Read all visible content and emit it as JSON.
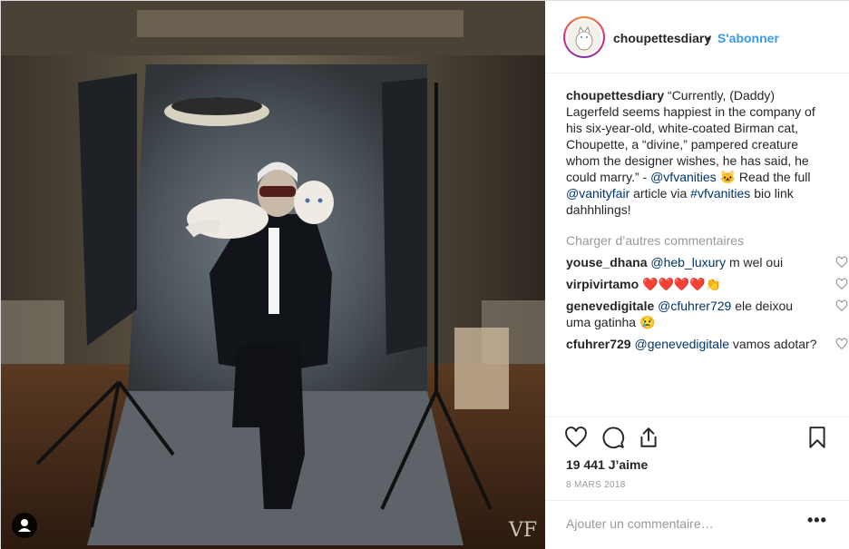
{
  "colors": {
    "accent": "#3897f0",
    "link": "#003569",
    "muted": "#999999",
    "heart_red": "#ed4956"
  },
  "photo": {
    "watermark": "VF",
    "user_tag_icon": "user-icon"
  },
  "header": {
    "username": "choupettesdiary",
    "separator": "•",
    "follow_label": "S'abonner"
  },
  "caption": {
    "username": "choupettesdiary",
    "text_1": "“Currently, (Daddy) Lagerfeld seems happiest in the company of his six-year-old, white-coated Birman cat, Choupette, a “divine,” pampered creature whom the designer wishes, he has said, he could marry.” - ",
    "mention_1": "@vfvanities",
    "emoji": "🐱",
    "text_2": " Read the full ",
    "mention_2": "@vanityfair",
    "text_3": " article via ",
    "hashtag": "#vfvanities",
    "text_4": " bio link dahhhlings!"
  },
  "load_more": "Charger d’autres commentaires",
  "comments": [
    {
      "user": "youse_dhana",
      "mention": "@heb_luxury",
      "text": " m wel oui"
    },
    {
      "user": "virpivirtamo",
      "mention": "",
      "text": "❤️❤️❤️❤️👏"
    },
    {
      "user": "genevedigitale",
      "mention": "@cfuhrer729",
      "text": " ele deixou uma gatinha 😢"
    },
    {
      "user": "cfuhrer729",
      "mention": "@genevedigitale",
      "text": " vamos adotar?"
    }
  ],
  "actions": {
    "like_icon": "heart-icon",
    "comment_icon": "comment-icon",
    "share_icon": "share-icon",
    "save_icon": "bookmark-icon"
  },
  "likes": "19 441 J’aime",
  "date": "8 MARS 2018",
  "add_comment": {
    "placeholder": "Ajouter un commentaire…",
    "more_label": "•••"
  }
}
